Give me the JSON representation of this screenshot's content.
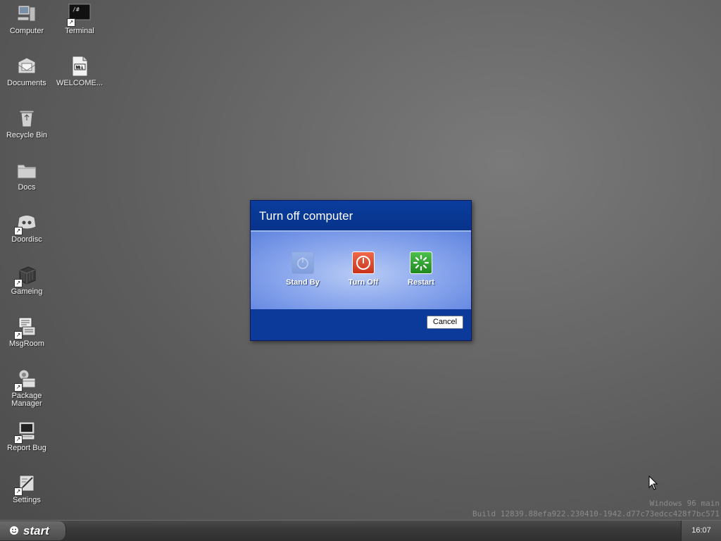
{
  "desktop": {
    "icons": [
      {
        "label": "Computer",
        "icon": "computer-icon"
      },
      {
        "label": "Terminal",
        "icon": "terminal-icon",
        "glyph_text": "/#"
      },
      {
        "label": "Documents",
        "icon": "documents-icon"
      },
      {
        "label": "WELCOME...",
        "icon": "markdown-file-icon",
        "glyph_text": "M↓"
      },
      {
        "label": "Recycle Bin",
        "icon": "recycle-bin-icon"
      },
      {
        "label": "Docs",
        "icon": "folder-icon"
      },
      {
        "label": "Doordisc",
        "icon": "doordisc-icon"
      },
      {
        "label": "Gameing",
        "icon": "game-cube-icon"
      },
      {
        "label": "MsgRoom",
        "icon": "msgroom-icon"
      },
      {
        "label": "Package Manager",
        "icon": "package-manager-icon"
      },
      {
        "label": "Report Bug",
        "icon": "report-bug-icon"
      },
      {
        "label": "Settings",
        "icon": "settings-icon"
      }
    ]
  },
  "dialog": {
    "title": "Turn off computer",
    "standby_label": "Stand By",
    "turnoff_label": "Turn Off",
    "restart_label": "Restart",
    "cancel_label": "Cancel"
  },
  "watermark": {
    "line1": "Windows 96 main",
    "line2": "Build 12839.88efa922.230410-1942.d77c73edcc428f7bc571"
  },
  "taskbar": {
    "start_label": "start",
    "clock": "16:07"
  },
  "colors": {
    "dialog_blue": "#0b3a9a",
    "turnoff_red": "#d9432a",
    "restart_green": "#2ea02e",
    "desktop_gray": "#5d5d5d"
  }
}
